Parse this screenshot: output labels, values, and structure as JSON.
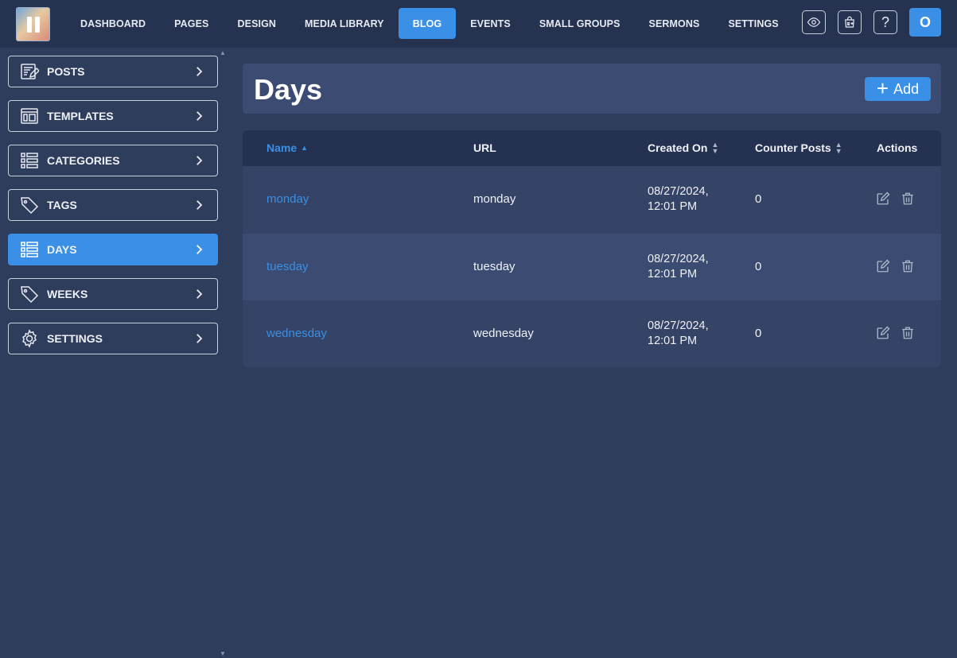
{
  "nav": {
    "items": [
      {
        "label": "DASHBOARD"
      },
      {
        "label": "PAGES"
      },
      {
        "label": "DESIGN"
      },
      {
        "label": "MEDIA LIBRARY"
      },
      {
        "label": "BLOG",
        "active": true
      },
      {
        "label": "EVENTS"
      },
      {
        "label": "SMALL GROUPS"
      },
      {
        "label": "SERMONS"
      },
      {
        "label": "SETTINGS"
      }
    ],
    "icons": [
      "eye-icon",
      "cart-icon",
      "help-icon"
    ],
    "help_glyph": "?",
    "avatar_initial": "O"
  },
  "sidebar": {
    "items": [
      {
        "label": "POSTS",
        "icon": "posts-icon"
      },
      {
        "label": "TEMPLATES",
        "icon": "templates-icon"
      },
      {
        "label": "CATEGORIES",
        "icon": "list-icon"
      },
      {
        "label": "TAGS",
        "icon": "tag-icon"
      },
      {
        "label": "DAYS",
        "icon": "list-icon",
        "active": true
      },
      {
        "label": "WEEKS",
        "icon": "tag-icon"
      },
      {
        "label": "SETTINGS",
        "icon": "gear-icon"
      }
    ]
  },
  "page": {
    "title": "Days",
    "add_label": "Add"
  },
  "table": {
    "columns": {
      "name": "Name",
      "url": "URL",
      "created_on": "Created On",
      "counter_posts": "Counter Posts",
      "actions": "Actions"
    },
    "rows": [
      {
        "name": "monday",
        "url": "monday",
        "created_date": "08/27/2024,",
        "created_time": "12:01 PM",
        "count": "0"
      },
      {
        "name": "tuesday",
        "url": "tuesday",
        "created_date": "08/27/2024,",
        "created_time": "12:01 PM",
        "count": "0"
      },
      {
        "name": "wednesday",
        "url": "wednesday",
        "created_date": "08/27/2024,",
        "created_time": "12:01 PM",
        "count": "0"
      }
    ]
  },
  "colors": {
    "accent": "#3a8fe6",
    "background": "#2f3d5c",
    "topbar": "#253250"
  }
}
